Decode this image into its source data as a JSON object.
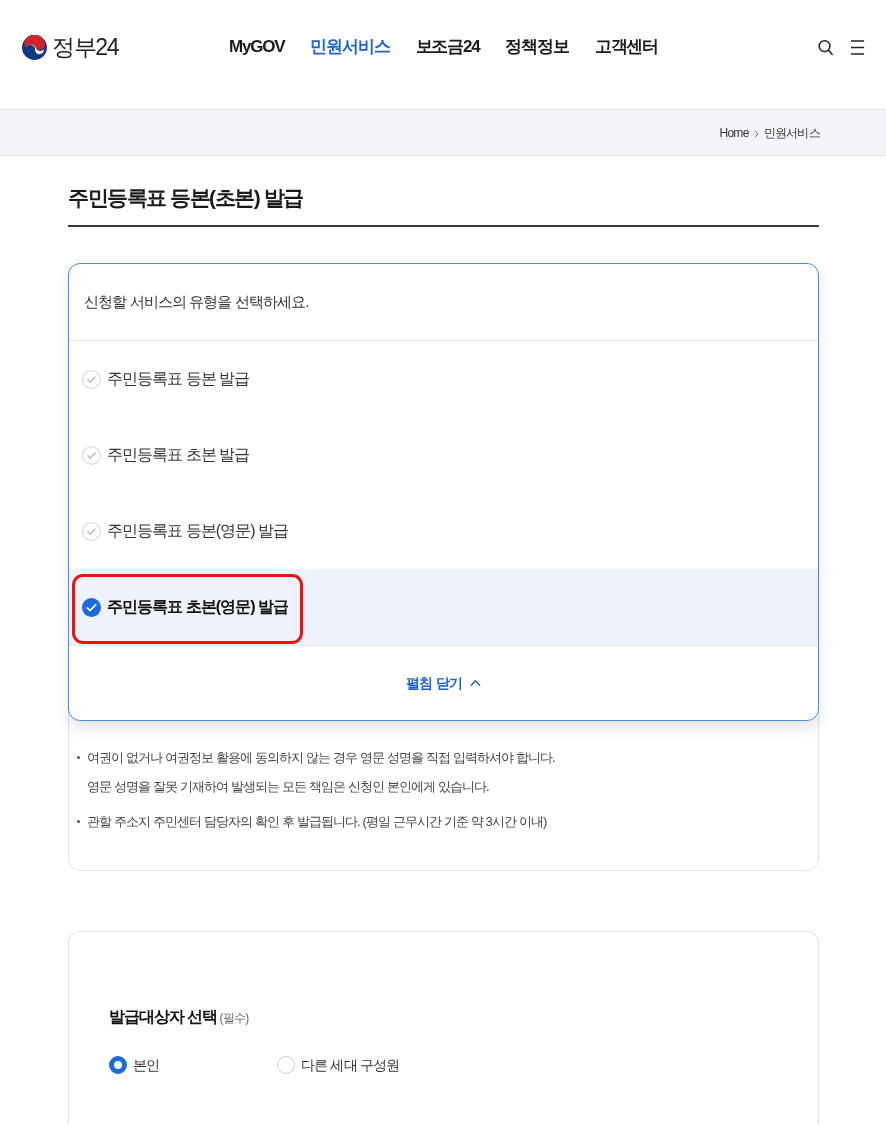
{
  "header": {
    "logo_text": "정부24",
    "nav": [
      {
        "label": "MyGOV",
        "selected": false
      },
      {
        "label": "민원서비스",
        "selected": true
      },
      {
        "label": "보조금24",
        "selected": false
      },
      {
        "label": "정책정보",
        "selected": false
      },
      {
        "label": "고객센터",
        "selected": false
      }
    ]
  },
  "breadcrumb": [
    "Home",
    "민원서비스"
  ],
  "page_title": "주민등록표 등본(초본) 발급",
  "service_select": {
    "prompt": "신청할 서비스의 유형을 선택하세요.",
    "expanded": true,
    "options": [
      {
        "label": "주민등록표 등본 발급",
        "selected": false,
        "highlighted": false
      },
      {
        "label": "주민등록표 초본 발급",
        "selected": false,
        "highlighted": false
      },
      {
        "label": "주민등록표 등본(영문) 발급",
        "selected": false,
        "highlighted": false
      },
      {
        "label": "주민등록표 초본(영문) 발급",
        "selected": true,
        "highlighted": true
      }
    ],
    "collapse_label": "펼침 닫기"
  },
  "notice": {
    "items": [
      {
        "lines": [
          "여권이 없거나 여권정보 활용에 동의하지 않는 경우 영문 성명을 직접 입력하셔야 합니다.",
          "영문 성명을 잘못 기재하여 발생되는 모든 책임은 신청인 본인에게 있습니다."
        ]
      },
      {
        "lines": [
          "관할 주소지 주민센터 담당자의 확인 후 발급됩니다. (평일 근무시간 기준 약 3시간 이내)"
        ]
      }
    ]
  },
  "target_select": {
    "title": "발급대상자 선택",
    "required_note": "(필수)",
    "options": [
      {
        "label": "본인",
        "selected": true
      },
      {
        "label": "다른 세대 구성원",
        "selected": false
      }
    ]
  }
}
